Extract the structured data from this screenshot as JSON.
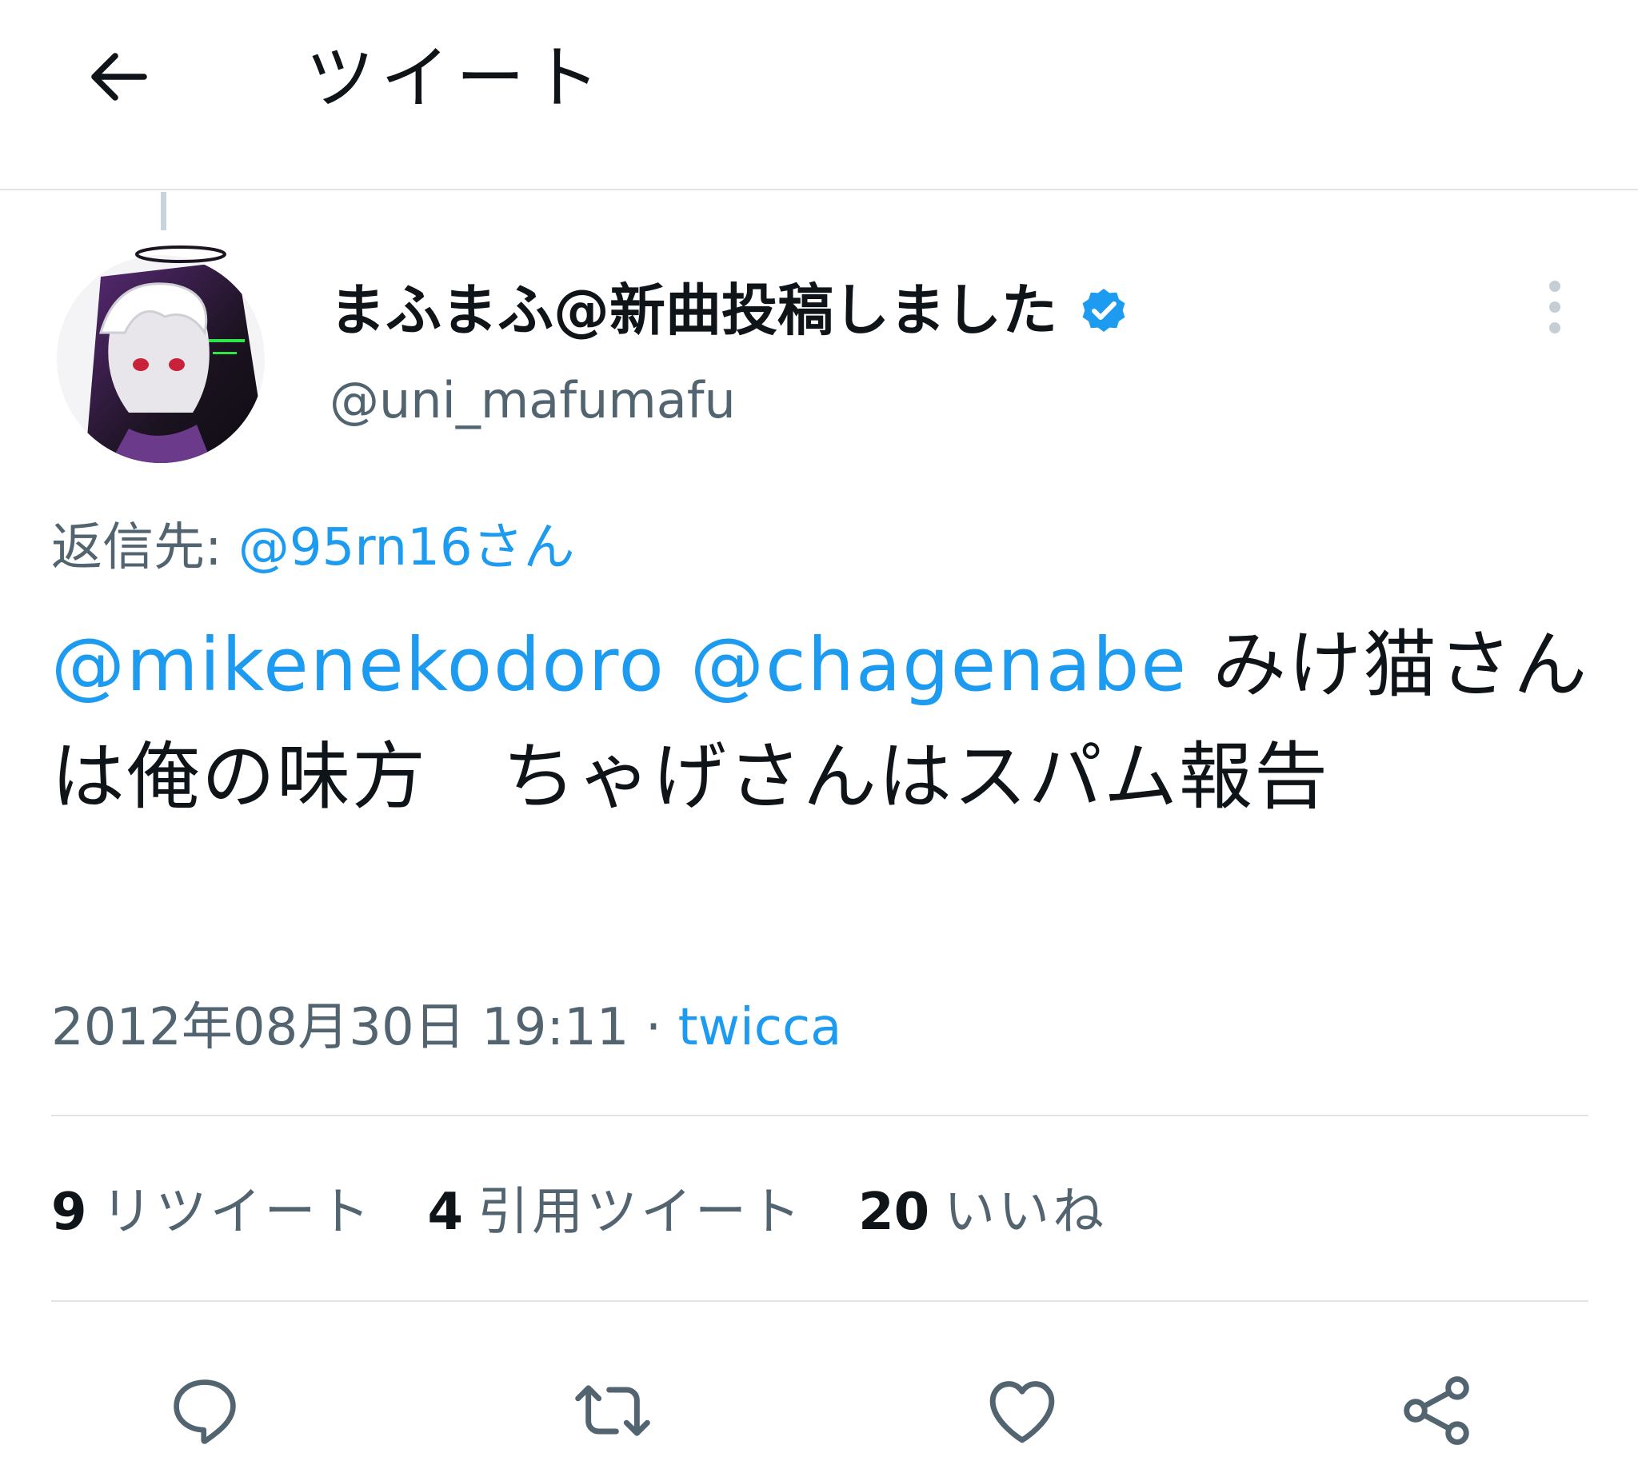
{
  "header": {
    "title": "ツイート",
    "back_icon": "arrow-left-icon"
  },
  "author": {
    "display_name": "まふまふ@新曲投稿しました",
    "handle": "@uni_mafumafu",
    "verified": true,
    "verified_color": "#1d9bf0"
  },
  "reply": {
    "prefix": "返信先: ",
    "target": "@95rn16さん"
  },
  "tweet": {
    "mention_1": "@mikenekodoro",
    "mention_2": "@chagenabe",
    "body": " みけ猫さんは俺の味方　ちゃげさんはスパム報告"
  },
  "meta": {
    "datetime": "2012年08月30日 19:11",
    "separator": " · ",
    "source": "twicca"
  },
  "stats": [
    {
      "count": "9",
      "label": "リツイート"
    },
    {
      "count": "4",
      "label": "引用ツイート"
    },
    {
      "count": "20",
      "label": "いいね"
    }
  ],
  "actions": [
    "reply-icon",
    "retweet-icon",
    "like-icon",
    "share-icon"
  ],
  "colors": {
    "accent": "#1d9bf0",
    "text": "#0f1419",
    "secondary": "#536471",
    "border": "#e1e5e8"
  }
}
